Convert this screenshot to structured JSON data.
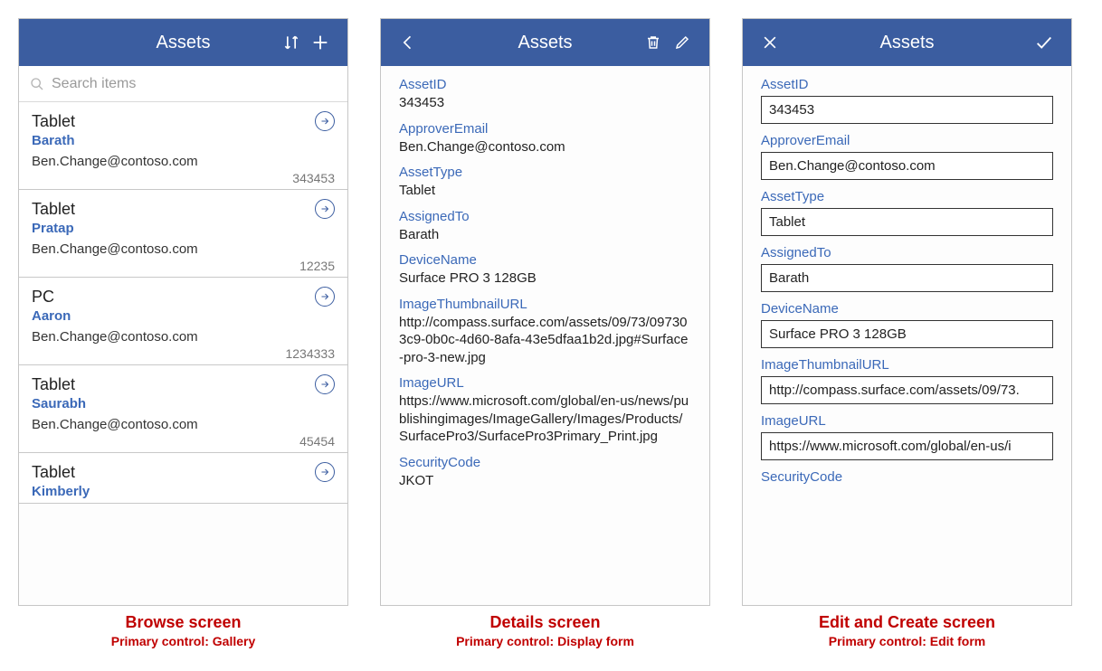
{
  "browse": {
    "title": "Assets",
    "search_placeholder": "Search items",
    "items": [
      {
        "type": "Tablet",
        "assigned": "Barath",
        "email": "Ben.Change@contoso.com",
        "id": "343453"
      },
      {
        "type": "Tablet",
        "assigned": "Pratap",
        "email": "Ben.Change@contoso.com",
        "id": "12235"
      },
      {
        "type": "PC",
        "assigned": "Aaron",
        "email": "Ben.Change@contoso.com",
        "id": "1234333"
      },
      {
        "type": "Tablet",
        "assigned": "Saurabh",
        "email": "Ben.Change@contoso.com",
        "id": "45454"
      },
      {
        "type": "Tablet",
        "assigned": "Kimberly",
        "email": "",
        "id": ""
      }
    ],
    "caption_title": "Browse screen",
    "caption_sub": "Primary control: Gallery"
  },
  "details": {
    "title": "Assets",
    "fields": [
      {
        "label": "AssetID",
        "value": "343453"
      },
      {
        "label": "ApproverEmail",
        "value": "Ben.Change@contoso.com"
      },
      {
        "label": "AssetType",
        "value": "Tablet"
      },
      {
        "label": "AssignedTo",
        "value": "Barath"
      },
      {
        "label": "DeviceName",
        "value": "Surface PRO 3 128GB"
      },
      {
        "label": "ImageThumbnailURL",
        "value": "http://compass.surface.com/assets/09/73/097303c9-0b0c-4d60-8afa-43e5dfaa1b2d.jpg#Surface-pro-3-new.jpg"
      },
      {
        "label": "ImageURL",
        "value": "https://www.microsoft.com/global/en-us/news/publishingimages/ImageGallery/Images/Products/SurfacePro3/SurfacePro3Primary_Print.jpg"
      },
      {
        "label": "SecurityCode",
        "value": "JKOT"
      }
    ],
    "caption_title": "Details screen",
    "caption_sub": "Primary control: Display form"
  },
  "edit": {
    "title": "Assets",
    "fields": [
      {
        "label": "AssetID",
        "value": "343453"
      },
      {
        "label": "ApproverEmail",
        "value": "Ben.Change@contoso.com"
      },
      {
        "label": "AssetType",
        "value": "Tablet"
      },
      {
        "label": "AssignedTo",
        "value": "Barath"
      },
      {
        "label": "DeviceName",
        "value": "Surface PRO 3 128GB"
      },
      {
        "label": "ImageThumbnailURL",
        "value": "http://compass.surface.com/assets/09/73."
      },
      {
        "label": "ImageURL",
        "value": "https://www.microsoft.com/global/en-us/i"
      },
      {
        "label": "SecurityCode",
        "value": ""
      }
    ],
    "caption_title": "Edit and Create screen",
    "caption_sub": "Primary control: Edit form"
  }
}
